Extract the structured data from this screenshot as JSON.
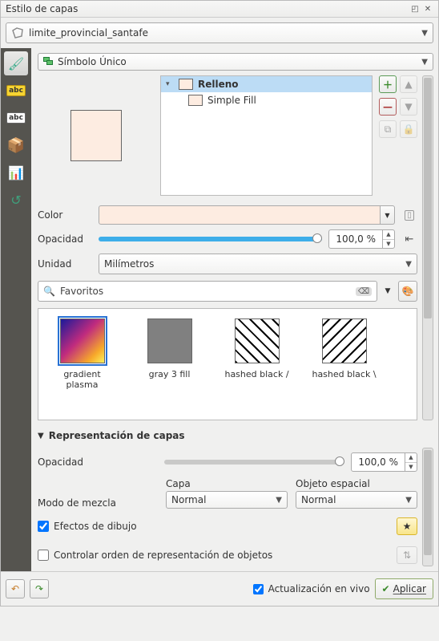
{
  "title": "Estilo de capas",
  "layer_combo": "limite_provincial_santafe",
  "symbol_combo": "Símbolo Único",
  "tree": {
    "parent": "Relleno",
    "child": "Simple Fill"
  },
  "labels": {
    "color": "Color",
    "opacity": "Opacidad",
    "unit": "Unidad"
  },
  "opacity_value": "100,0 %",
  "unit_value": "Milímetros",
  "favorites": "Favoritos",
  "styles": [
    {
      "name": "gradient plasma"
    },
    {
      "name": "gray 3 fill"
    },
    {
      "name": "hashed black /"
    },
    {
      "name": "hashed black \\"
    }
  ],
  "repr": {
    "title": "Representación de capas",
    "opacity_label": "Opacidad",
    "opacity_value": "100,0 %",
    "blend_label": "Modo de mezcla",
    "blend_layer_h": "Capa",
    "blend_feature_h": "Objeto espacial",
    "blend_layer": "Normal",
    "blend_feature": "Normal",
    "draw_effects": "Efectos de dibujo",
    "control_order": "Controlar orden de representación de objetos"
  },
  "live_update": "Actualización en vivo",
  "apply": "Aplicar"
}
